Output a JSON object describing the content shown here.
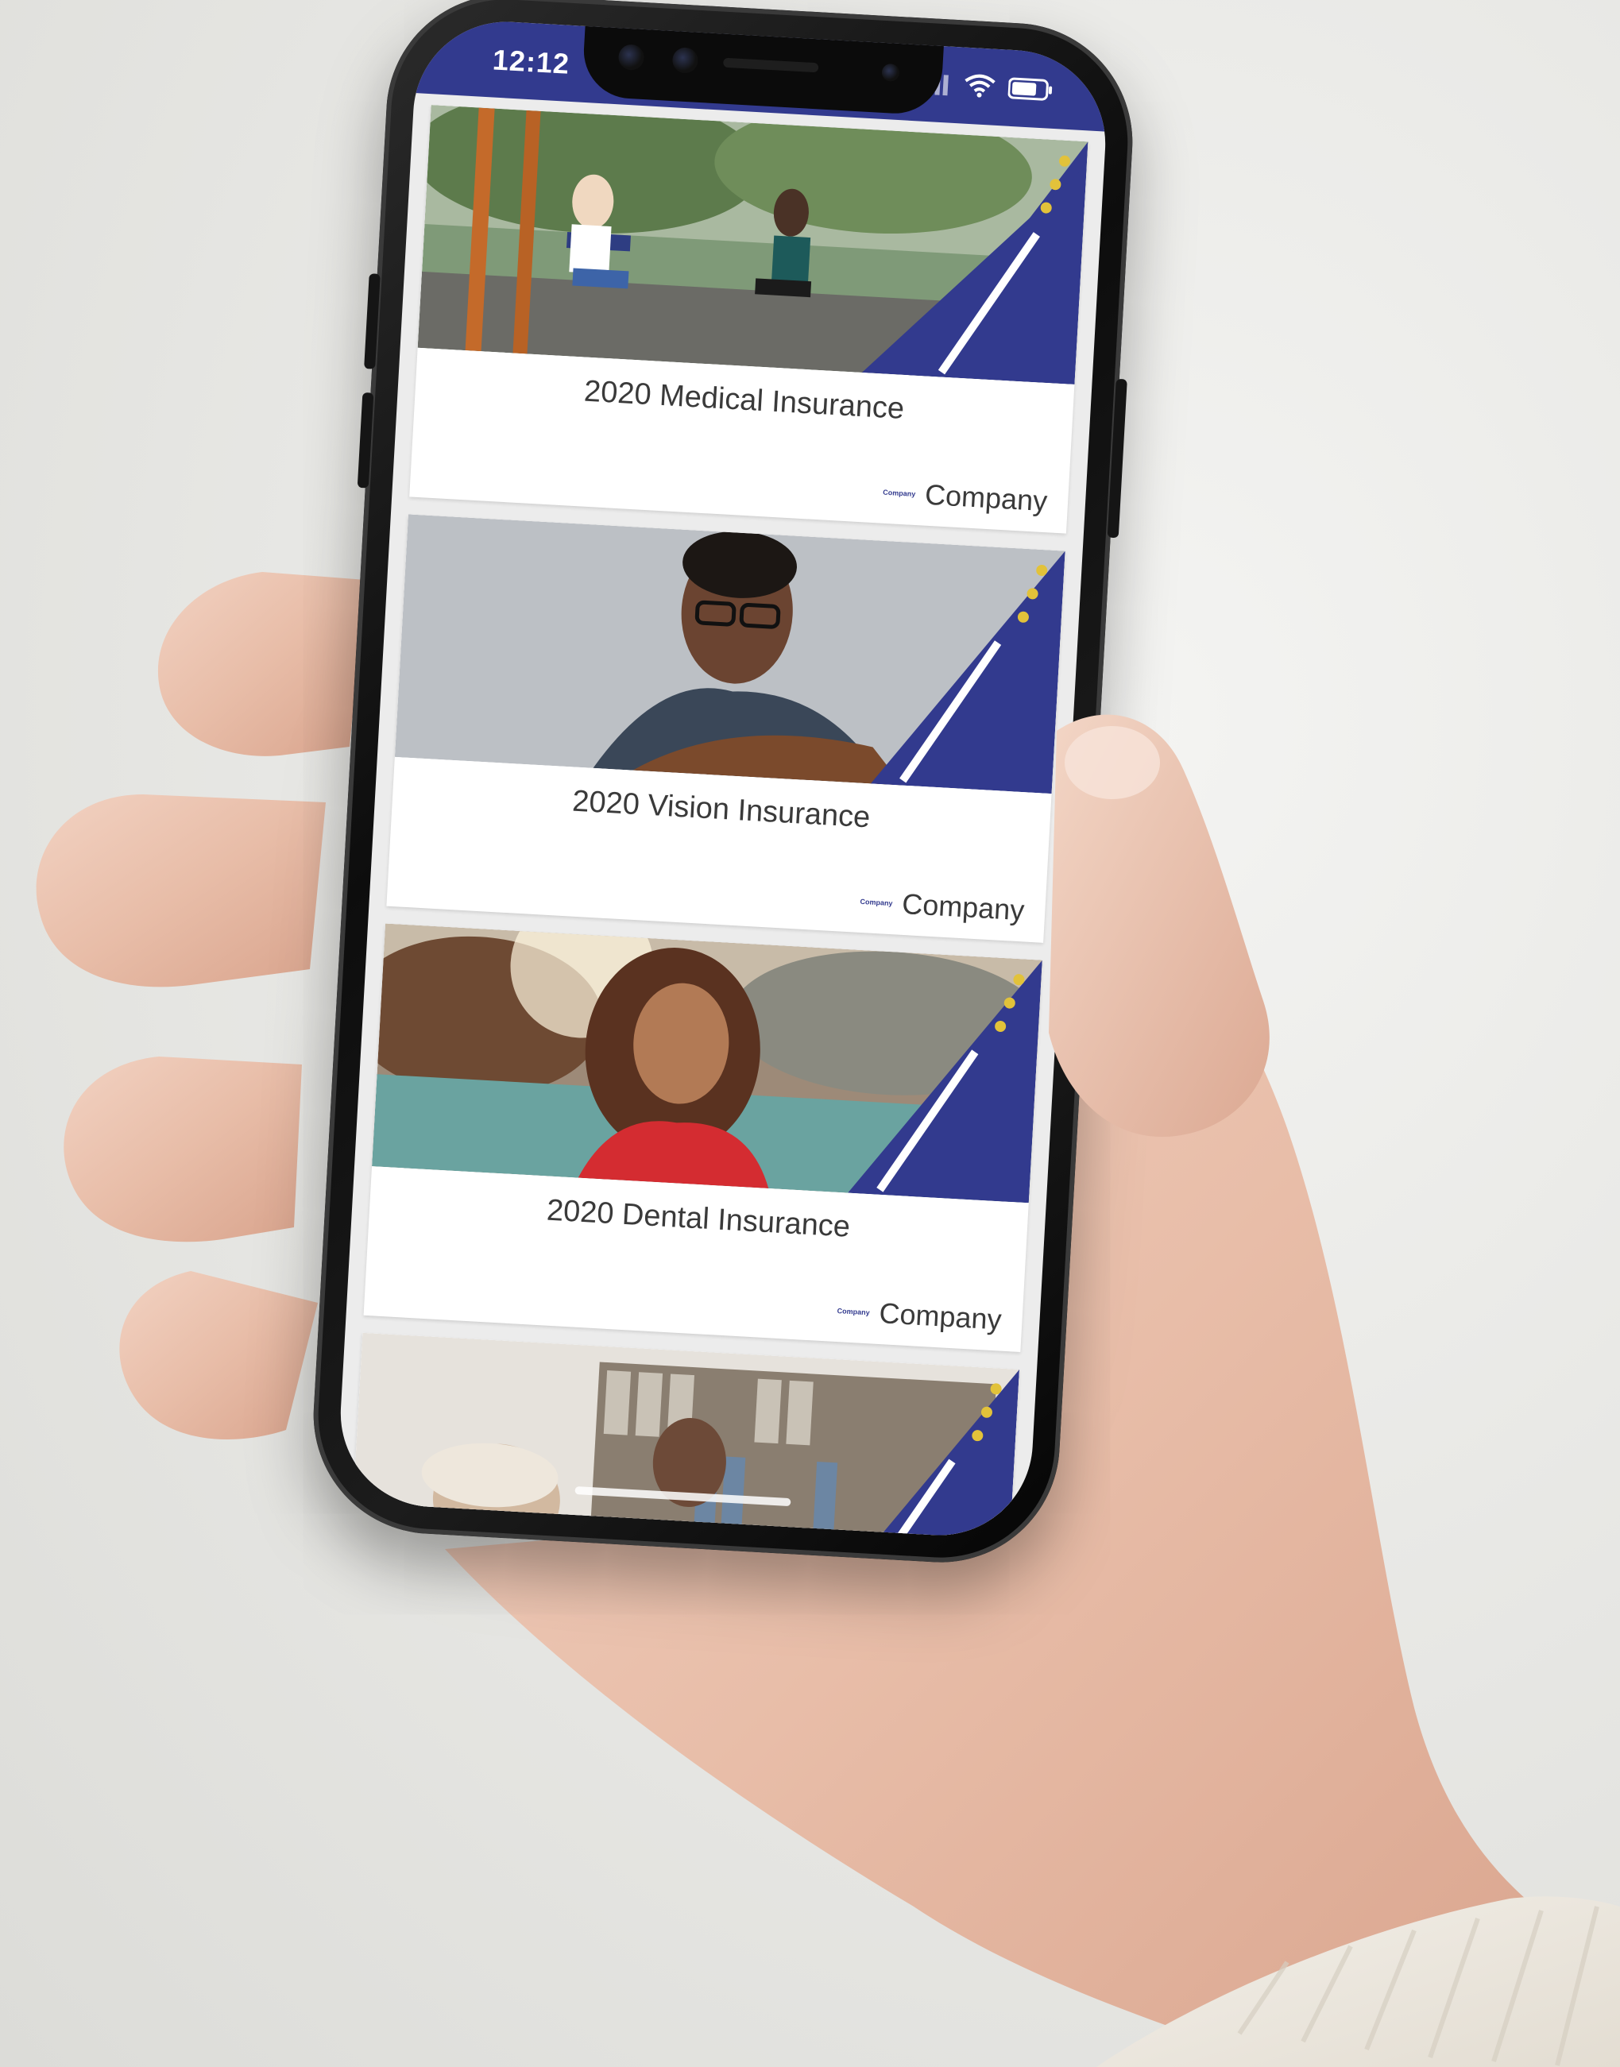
{
  "status_bar": {
    "time": "12:12",
    "color": "#323a8e"
  },
  "feed": {
    "cards": [
      {
        "title": "2020 Medical Insurance",
        "brand_mini": "Company",
        "brand": "Company",
        "photo": "people-on-swings"
      },
      {
        "title": "2020 Vision Insurance",
        "brand_mini": "Company",
        "brand": "Company",
        "photo": "man-with-guitar"
      },
      {
        "title": "2020 Dental Insurance",
        "brand_mini": "Company",
        "brand": "Company",
        "photo": "smiling-woman-outdoors"
      },
      {
        "title": "",
        "brand_mini": "",
        "brand": "",
        "photo": "people-in-library"
      }
    ]
  },
  "colors": {
    "accent_navy": "#323a8e",
    "accent_dot": "#e2c23a",
    "card_bg": "#ffffff",
    "screen_bg": "#ececec"
  },
  "icons": [
    "signal-icon",
    "wifi-icon",
    "battery-icon"
  ]
}
